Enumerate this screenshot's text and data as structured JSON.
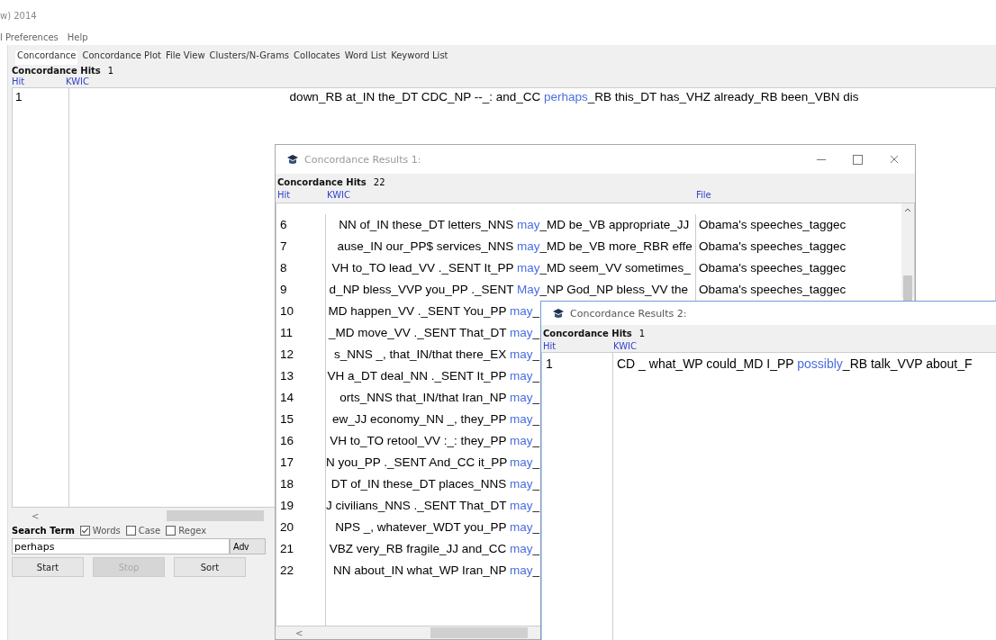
{
  "main": {
    "title": "w) 2014",
    "menu": [
      "l Preferences",
      "Help"
    ],
    "tabs": [
      {
        "label": "Concordance",
        "selected": true
      },
      {
        "label": "Concordance Plot",
        "selected": false
      },
      {
        "label": "File View",
        "selected": false
      },
      {
        "label": "Clusters/N-Grams",
        "selected": false
      },
      {
        "label": "Collocates",
        "selected": false
      },
      {
        "label": "Word List",
        "selected": false
      },
      {
        "label": "Keyword List",
        "selected": false
      }
    ],
    "hits_label": "Concordance Hits",
    "hits": "1",
    "columns": [
      "Hit",
      "KWIC"
    ],
    "rows": [
      {
        "hit": "1",
        "left": "down_RB at_IN the_DT CDC_NP --_: and_CC ",
        "key": "perhaps",
        "right": "_RB this_DT has_VHZ already_RB been_VBN dis"
      }
    ],
    "scroll_arrow": "<",
    "search_label": "Search Term",
    "options": [
      {
        "label": "Words",
        "checked": true
      },
      {
        "label": "Case",
        "checked": false
      },
      {
        "label": "Regex",
        "checked": false
      }
    ],
    "search_value": "perhaps",
    "advanced": "Adv",
    "buttons": [
      {
        "label": "Start",
        "disabled": false
      },
      {
        "label": "Stop",
        "disabled": true
      },
      {
        "label": "Sort",
        "disabled": false
      }
    ]
  },
  "results1": {
    "title": "Concordance Results 1:",
    "hits_label": "Concordance Hits",
    "hits": "22",
    "columns": [
      "Hit",
      "KWIC",
      "File"
    ],
    "rows": [
      {
        "hit": "6",
        "left": "NN of_IN these_DT letters_NNS ",
        "key": "may",
        "right": "_MD be_VB appropriate_JJ",
        "file": "Obama's speeches_taggec"
      },
      {
        "hit": "7",
        "left": "ause_IN our_PP$ services_NNS ",
        "key": "may",
        "right": "_MD be_VB more_RBR effe",
        "file": "Obama's speeches_taggec"
      },
      {
        "hit": "8",
        "left": "VH to_TO lead_VV ._SENT It_PP ",
        "key": "may",
        "right": "_MD seem_VV sometimes_",
        "file": "Obama's speeches_taggec"
      },
      {
        "hit": "9",
        "left": "d_NP bless_VVP you_PP ._SENT ",
        "key": "May",
        "right": "_NP God_NP bless_VV the",
        "file": "Obama's speeches_taggec"
      },
      {
        "hit": "10",
        "left": "MD happen_VV ._SENT You_PP ",
        "key": "may",
        "right": "_"
      },
      {
        "hit": "11",
        "left": "_MD move_VV ._SENT That_DT ",
        "key": "may",
        "right": "_"
      },
      {
        "hit": "12",
        "left": "s_NNS _, that_IN/that there_EX ",
        "key": "may",
        "right": "_"
      },
      {
        "hit": "13",
        "left": "VH a_DT deal_NN ._SENT It_PP ",
        "key": "may",
        "right": "_"
      },
      {
        "hit": "14",
        "left": "orts_NNS that_IN/that Iran_NP ",
        "key": "may",
        "right": "_"
      },
      {
        "hit": "15",
        "left": "ew_JJ economy_NN _, they_PP ",
        "key": "may",
        "right": "_"
      },
      {
        "hit": "16",
        "left": "VH to_TO retool_VV :_: they_PP ",
        "key": "may",
        "right": "_"
      },
      {
        "hit": "17",
        "left": "N you_PP ._SENT And_CC it_PP ",
        "key": "may",
        "right": "_"
      },
      {
        "hit": "18",
        "left": "DT of_IN these_DT places_NNS ",
        "key": "may",
        "right": "_"
      },
      {
        "hit": "19",
        "left": "J civilians_NNS ._SENT That_DT ",
        "key": "may",
        "right": "_"
      },
      {
        "hit": "20",
        "left": "NPS _, whatever_WDT you_PP ",
        "key": "may",
        "right": "_"
      },
      {
        "hit": "21",
        "left": "VBZ very_RB fragile_JJ and_CC ",
        "key": "may",
        "right": "_"
      },
      {
        "hit": "22",
        "left": "NN about_IN what_WP Iran_NP ",
        "key": "may",
        "right": "_"
      }
    ],
    "scroll_arrow": "<"
  },
  "results2": {
    "title": "Concordance Results 2:",
    "hits_label": "Concordance Hits",
    "hits": "1",
    "columns": [
      "Hit",
      "KWIC"
    ],
    "rows": [
      {
        "hit": "1",
        "left": "CD _ what_WP could_MD I_PP ",
        "key": "possibly",
        "right": "_RB talk_VVP about_F"
      }
    ]
  }
}
